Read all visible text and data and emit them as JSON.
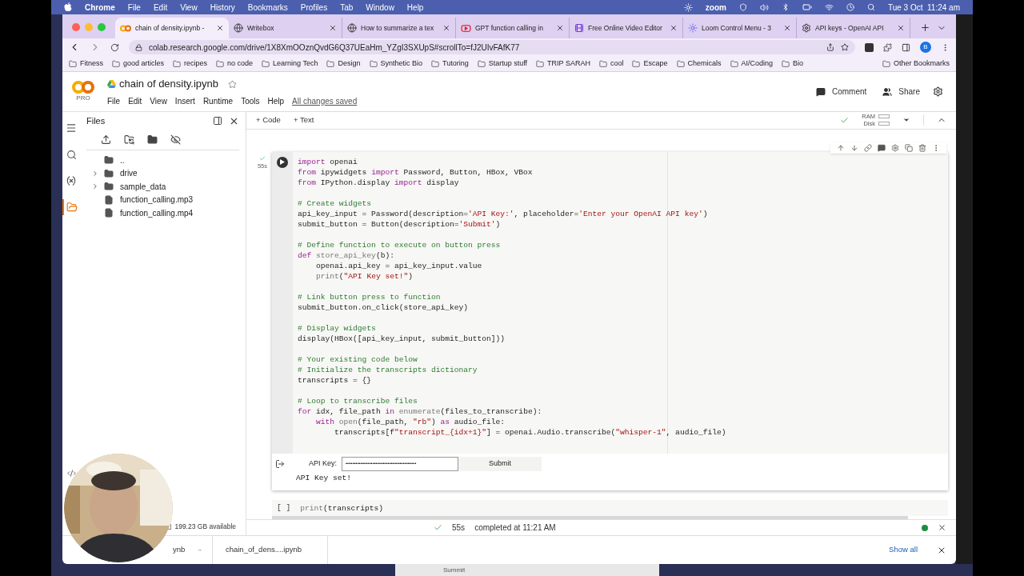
{
  "menubar": {
    "app": "Chrome",
    "items": [
      "File",
      "Edit",
      "View",
      "History",
      "Bookmarks",
      "Profiles",
      "Tab",
      "Window",
      "Help"
    ],
    "zoom_label": "zoom",
    "clock": "Tue 3 Oct  11:24 am"
  },
  "tabs": [
    {
      "label": "chain of density.ipynb -",
      "selected": true,
      "kind": "colab"
    },
    {
      "label": "Writebox",
      "selected": false,
      "kind": "globe"
    },
    {
      "label": "How to summarize a tex",
      "selected": false,
      "kind": "globe"
    },
    {
      "label": "GPT function calling in",
      "selected": false,
      "kind": "youtube"
    },
    {
      "label": "Free Online Video Editor",
      "selected": false,
      "kind": "video"
    },
    {
      "label": "Loom Control Menu - 3",
      "selected": false,
      "kind": "loom"
    },
    {
      "label": "API keys - OpenAI API",
      "selected": false,
      "kind": "openai"
    }
  ],
  "address": "colab.research.google.com/drive/1X8XmOOznQvdG6Q37UEaHm_YZgI3SXUpS#scrollTo=fJ2UIvFAfK77",
  "profile_initial": "B",
  "bookmarks": [
    "Fitness",
    "good articles",
    "recipes",
    "no code",
    "Learning Tech",
    "Design",
    "Synthetic Bio",
    "Tutoring",
    "Startup stuff",
    "TRIP SARAH",
    "cool",
    "Escape",
    "Chemicals",
    "AI/Coding",
    "Bio"
  ],
  "other_bookmarks": "Other Bookmarks",
  "colab": {
    "logo_sub": "PRO",
    "title": "chain of density.ipynb",
    "menu": [
      "File",
      "Edit",
      "View",
      "Insert",
      "Runtime",
      "Tools",
      "Help"
    ],
    "saved": "All changes saved",
    "comment": "Comment",
    "share": "Share",
    "add_code": "+ Code",
    "add_text": "+ Text",
    "ram": "RAM",
    "disk": "Disk"
  },
  "rail": [
    {
      "kind": "toc",
      "selected": false
    },
    {
      "kind": "search",
      "selected": false
    },
    {
      "kind": "variables",
      "selected": false
    },
    {
      "kind": "files",
      "selected": true
    }
  ],
  "files": {
    "title": "Files",
    "items": [
      {
        "kind": "parent",
        "name": ".."
      },
      {
        "kind": "folder",
        "name": "drive",
        "expanded": false
      },
      {
        "kind": "folder",
        "name": "sample_data",
        "expanded": false
      },
      {
        "kind": "file",
        "name": "function_calling.mp3"
      },
      {
        "kind": "file",
        "name": "function_calling.mp4"
      }
    ],
    "disk": "199.23 GB available"
  },
  "cell": {
    "time": "55s",
    "blocks": [
      [
        [
          {
            "kind": "keyword",
            "text": "import"
          },
          {
            "kind": "plain",
            "text": " openai"
          }
        ],
        [
          {
            "kind": "keyword",
            "text": "from"
          },
          {
            "kind": "plain",
            "text": " ipywidgets "
          },
          {
            "kind": "keyword",
            "text": "import"
          },
          {
            "kind": "plain",
            "text": " Password, Button, HBox, VBox"
          }
        ],
        [
          {
            "kind": "keyword",
            "text": "from"
          },
          {
            "kind": "plain",
            "text": " IPython.display "
          },
          {
            "kind": "keyword",
            "text": "import"
          },
          {
            "kind": "plain",
            "text": " display"
          }
        ]
      ],
      [
        [
          {
            "kind": "comment",
            "text": "# Create widgets"
          }
        ],
        [
          {
            "kind": "plain",
            "text": "api_key_input = Password(description="
          },
          {
            "kind": "string",
            "text": "'API Key:'"
          },
          {
            "kind": "plain",
            "text": ", placeholder="
          },
          {
            "kind": "string",
            "text": "'Enter your OpenAI API key'"
          },
          {
            "kind": "plain",
            "text": ")"
          }
        ],
        [
          {
            "kind": "plain",
            "text": "submit_button = Button(description="
          },
          {
            "kind": "string",
            "text": "'Submit'"
          },
          {
            "kind": "plain",
            "text": ")"
          }
        ]
      ],
      [
        [
          {
            "kind": "comment",
            "text": "# Define function to execute on button press"
          }
        ],
        [
          {
            "kind": "keyword",
            "text": "def "
          },
          {
            "kind": "builtin",
            "text": "store_api_key"
          },
          {
            "kind": "plain",
            "text": "(b):"
          }
        ],
        [
          {
            "kind": "plain",
            "text": "    openai.api_key = api_key_input.value"
          }
        ],
        [
          {
            "kind": "builtin",
            "text": "    print"
          },
          {
            "kind": "plain",
            "text": "("
          },
          {
            "kind": "string",
            "text": "\"API Key set!\""
          },
          {
            "kind": "plain",
            "text": ")"
          }
        ]
      ],
      [
        [
          {
            "kind": "comment",
            "text": "# Link button press to function"
          }
        ],
        [
          {
            "kind": "plain",
            "text": "submit_button.on_click(store_api_key)"
          }
        ]
      ],
      [
        [
          {
            "kind": "comment",
            "text": "# Display widgets"
          }
        ],
        [
          {
            "kind": "plain",
            "text": "display(HBox([api_key_input, submit_button]))"
          }
        ]
      ],
      [
        [
          {
            "kind": "comment",
            "text": "# Your existing code below"
          }
        ],
        [
          {
            "kind": "comment",
            "text": "# Initialize the transcripts dictionary"
          }
        ],
        [
          {
            "kind": "plain",
            "text": "transcripts = {}"
          }
        ]
      ],
      [
        [
          {
            "kind": "comment",
            "text": "# Loop to transcribe files"
          }
        ],
        [
          {
            "kind": "keyword",
            "text": "for"
          },
          {
            "kind": "plain",
            "text": " idx, file_path "
          },
          {
            "kind": "keyword",
            "text": "in"
          },
          {
            "kind": "builtin",
            "text": " enumerate"
          },
          {
            "kind": "plain",
            "text": "(files_to_transcribe):"
          }
        ],
        [
          {
            "kind": "keyword",
            "text": "    with"
          },
          {
            "kind": "builtin",
            "text": " open"
          },
          {
            "kind": "plain",
            "text": "(file_path, "
          },
          {
            "kind": "string",
            "text": "\"rb\""
          },
          {
            "kind": "plain",
            "text": ") "
          },
          {
            "kind": "keyword",
            "text": "as"
          },
          {
            "kind": "plain",
            "text": " audio_file:"
          }
        ],
        [
          {
            "kind": "plain",
            "text": "        transcripts[f"
          },
          {
            "kind": "string",
            "text": "\"transcript_{idx+1}\""
          },
          {
            "kind": "plain",
            "text": "] = openai.Audio.transcribe("
          },
          {
            "kind": "string",
            "text": "\"whisper-1\""
          },
          {
            "kind": "plain",
            "text": ", audio_file)"
          }
        ]
      ]
    ],
    "output": {
      "label": "API Key:",
      "value": "••••••••••••••••••••••••••••••••••••••••••",
      "button": "Submit",
      "printed": "API Key set!"
    }
  },
  "next_cell": {
    "brackets": "[ ]",
    "code": [
      {
        "kind": "builtin",
        "text": "print"
      },
      {
        "kind": "plain",
        "text": "(transcripts)"
      }
    ]
  },
  "status": {
    "time": "55s",
    "text": "completed at 11:21 AM"
  },
  "downloads": [
    {
      "name": "ynb"
    },
    {
      "name": "chain_of_dens....ipynb"
    }
  ],
  "show_all": "Show all",
  "desktop_text": "Summit"
}
